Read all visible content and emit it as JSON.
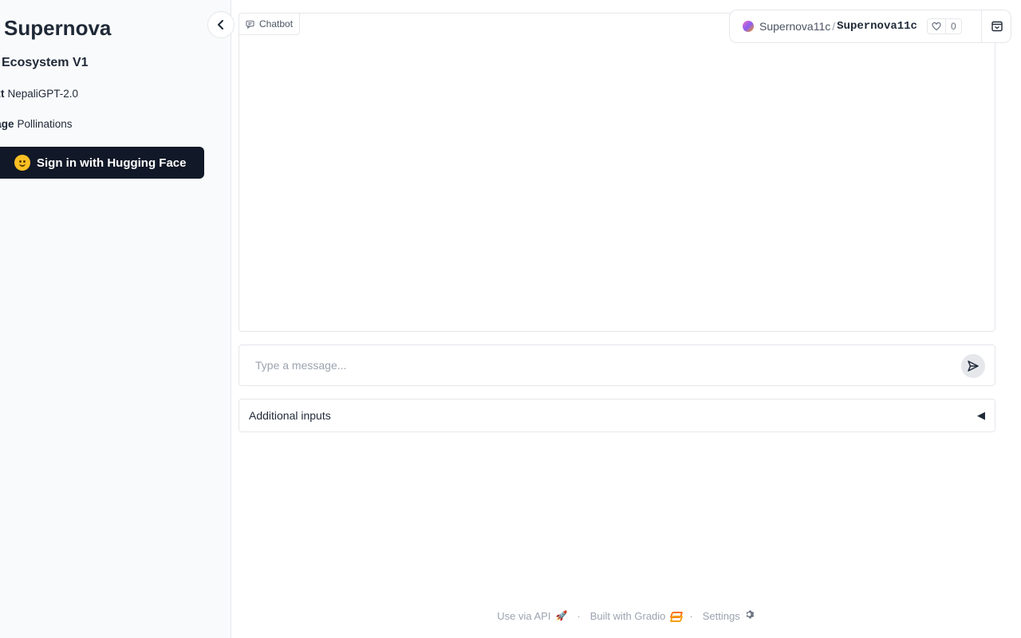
{
  "sidebar": {
    "brand": "Supernova",
    "subtitle": "Ecosystem V1",
    "rows": [
      {
        "key": "ext",
        "value": "NepaliGPT-2.0"
      },
      {
        "key": "nage",
        "value": "Pollinations"
      }
    ],
    "signin_label": "Sign in with Hugging Face"
  },
  "chatbot": {
    "label": "Chatbot"
  },
  "message": {
    "placeholder": "Type a message...",
    "value": ""
  },
  "accordion": {
    "label": "Additional inputs",
    "arrow": "◀"
  },
  "badge": {
    "owner": "Supernova11c",
    "slash": "/",
    "repo": "Supernova11c",
    "likes": "0"
  },
  "footer": {
    "api": "Use via API",
    "built": "Built with Gradio",
    "settings": "Settings",
    "separator": "·"
  },
  "icons": {
    "collapse": "chevron-left-icon",
    "chat": "chat-bubble-icon",
    "send": "paper-plane-icon",
    "heart": "heart-icon",
    "panel": "panel-collapse-icon",
    "rocket": "rocket-icon",
    "gradio": "gradio-logo-icon",
    "gear": "gear-icon"
  },
  "colors": {
    "sidebar_bg": "#f9fafb",
    "signin_bg": "#111827",
    "accent": "#f97316"
  }
}
